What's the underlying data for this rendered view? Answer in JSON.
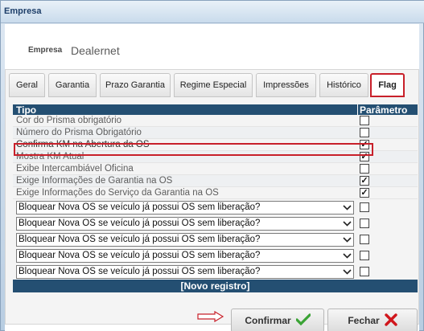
{
  "window": {
    "title": "Empresa"
  },
  "empresa": {
    "label": "Empresa",
    "value": "Dealernet"
  },
  "tabs": [
    {
      "label": "Geral"
    },
    {
      "label": "Garantia"
    },
    {
      "label": "Prazo Garantia"
    },
    {
      "label": "Regime Especial"
    },
    {
      "label": "Impressões"
    },
    {
      "label": "Histórico"
    },
    {
      "label": "Flag",
      "active": true
    }
  ],
  "grid": {
    "headers": {
      "tipo": "Tipo",
      "parametro": "Parâmetro"
    },
    "rows": [
      {
        "label": "Cor do Prisma obrigatório",
        "checked": false
      },
      {
        "label": "Número do Prisma Obrigatório",
        "checked": false
      },
      {
        "label": "Confirma KM na Abertura da OS",
        "checked": true,
        "highlighted": true
      },
      {
        "label": "Mostra KM Atual",
        "checked": true
      },
      {
        "label": "Exibe Intercambiável Oficina",
        "checked": false
      },
      {
        "label": "Exige Informações de Garantia na OS",
        "checked": true
      },
      {
        "label": "Exige Informações do Serviço da Garantia na OS",
        "checked": true
      }
    ],
    "dropdown_rows": [
      {
        "value": "Bloquear Nova OS se veículo já possui OS sem liberação?",
        "checked": false
      },
      {
        "value": "Bloquear Nova OS se veículo já possui OS sem liberação?",
        "checked": false
      },
      {
        "value": "Bloquear Nova OS se veículo já possui OS sem liberação?",
        "checked": false
      },
      {
        "value": "Bloquear Nova OS se veículo já possui OS sem liberação?",
        "checked": false
      },
      {
        "value": "Bloquear Nova OS se veículo já possui OS sem liberação?",
        "checked": false
      }
    ],
    "new_record_label": "[Novo registro]"
  },
  "footer": {
    "confirm_label": "Confirmar",
    "close_label": "Fechar"
  },
  "colors": {
    "header_bg": "#244f72",
    "highlight": "#c8202a",
    "confirm_icon": "#3aa335",
    "close_icon": "#d0161c"
  },
  "icons": {
    "confirm": "check-icon",
    "close": "x-icon",
    "dropdown": "chevron-down-icon",
    "annotation": "arrow-right-icon"
  }
}
